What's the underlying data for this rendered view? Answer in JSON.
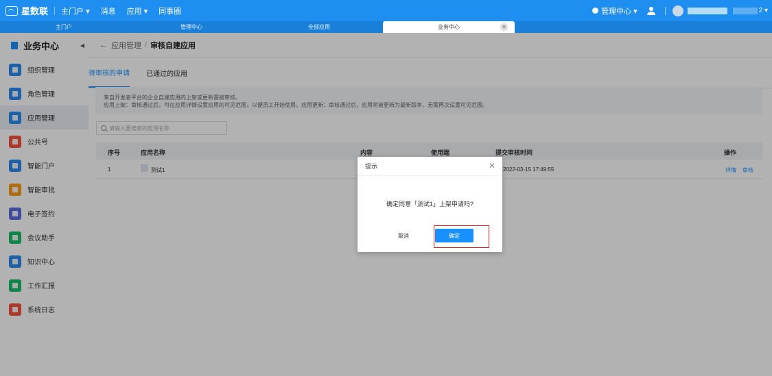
{
  "topbar": {
    "app_name": "星数联",
    "nav": [
      "主门户 ▾",
      "消息",
      "应用 ▾",
      "同事圈"
    ],
    "mgmt_center": "管理中心 ▾",
    "user_name": "2 ▾"
  },
  "window_tabs": [
    {
      "label": "主门户",
      "active": false
    },
    {
      "label": "管理中心",
      "active": false
    },
    {
      "label": "全部应用",
      "active": false
    },
    {
      "label": "业务中心",
      "active": true
    }
  ],
  "sidebar": {
    "title": "业务中心",
    "items": [
      {
        "label": "组织管理",
        "icon": "org-icon",
        "color": "#2d8cf0",
        "active": false
      },
      {
        "label": "角色管理",
        "icon": "role-icon",
        "color": "#2d8cf0",
        "active": false
      },
      {
        "label": "应用管理",
        "icon": "app-icon",
        "color": "#2d8cf0",
        "active": true
      },
      {
        "label": "公共号",
        "icon": "public-account-icon",
        "color": "#f5533d",
        "active": false
      },
      {
        "label": "智能门户",
        "icon": "portal-icon",
        "color": "#2d8cf0",
        "active": false
      },
      {
        "label": "智能审批",
        "icon": "approval-icon",
        "color": "#fa9d1a",
        "active": false
      },
      {
        "label": "电子签约",
        "icon": "contract-icon",
        "color": "#5b6ee1",
        "active": false
      },
      {
        "label": "会议助手",
        "icon": "meeting-icon",
        "color": "#19be6b",
        "active": false
      },
      {
        "label": "知识中心",
        "icon": "knowledge-icon",
        "color": "#2d8cf0",
        "active": false
      },
      {
        "label": "工作汇报",
        "icon": "report-icon",
        "color": "#19be6b",
        "active": false
      },
      {
        "label": "系统日志",
        "icon": "log-icon",
        "color": "#f5533d",
        "active": false
      }
    ]
  },
  "breadcrumb": {
    "parent": "应用管理",
    "separator": "/",
    "current": "审核自建应用"
  },
  "subtabs": [
    {
      "label": "待审核的申请",
      "active": true
    },
    {
      "label": "已通过的应用",
      "active": false
    }
  ],
  "notice": {
    "line1": "来自开发者平台的企业自建应用的上架或更新需被审核。",
    "line2": "应用上架：审核通过后，可在应用详情设置应用的可见范围，以便员工开始使用。应用更新：审核通过后，应用将被更新为最新版本，无需再次设置可见范围。"
  },
  "search": {
    "placeholder": "请输入要搜索的应用名称"
  },
  "table": {
    "headers": {
      "index": "序号",
      "name": "应用名称",
      "content": "内容",
      "client": "使用端",
      "submit_time": "提交审核时间",
      "actions": "操作"
    },
    "rows": [
      {
        "index": "1",
        "name": "测试1",
        "submit_time": "2022-03-15 17:49:55",
        "detail": "详情",
        "review": "审核"
      }
    ]
  },
  "dialog": {
    "title": "提示",
    "message": "确定同意「测试1」上架申请吗?",
    "cancel": "取消",
    "ok": "确定"
  },
  "colors": {
    "primary": "#1890ff",
    "topbar": "#1e8ff0",
    "highlight": "#e02020"
  }
}
